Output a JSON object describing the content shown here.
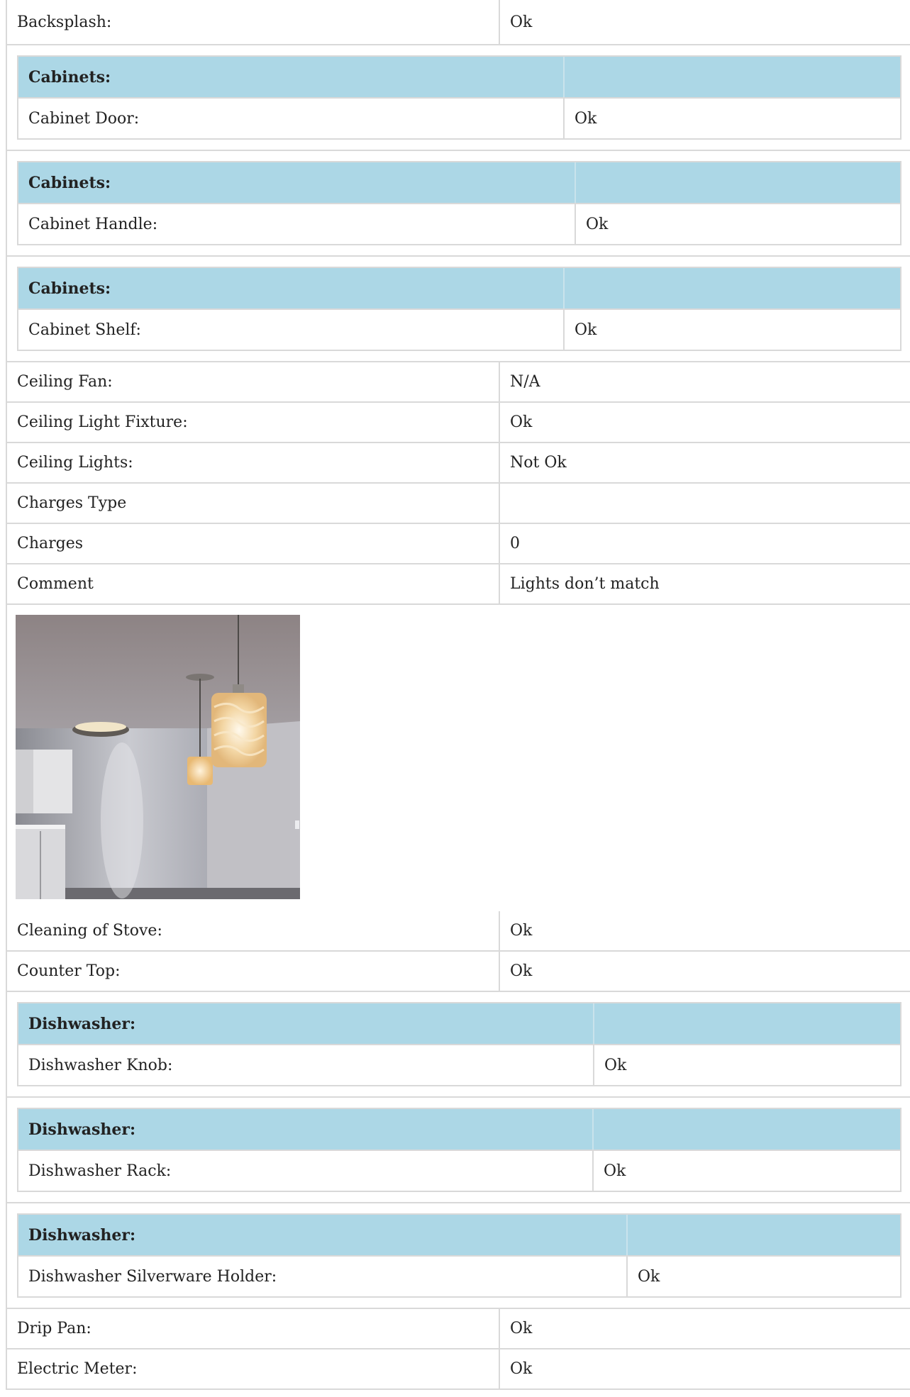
{
  "rows_top": [
    {
      "label": "Backsplash:",
      "value": "Ok"
    }
  ],
  "cabinet_groups": [
    {
      "header": "Cabinets:",
      "item": "Cabinet Door:",
      "value": "Ok"
    },
    {
      "header": "Cabinets:",
      "item": "Cabinet Handle:",
      "value": "Ok"
    },
    {
      "header": "Cabinets:",
      "item": "Cabinet Shelf:",
      "value": "Ok"
    }
  ],
  "rows_middle": [
    {
      "label": "Ceiling Fan:",
      "value": "N/A"
    },
    {
      "label": "Ceiling Light Fixture:",
      "value": "Ok"
    },
    {
      "label": "Ceiling Lights:",
      "value": "Not Ok"
    },
    {
      "label": "Charges Type",
      "value": ""
    },
    {
      "label": "Charges",
      "value": "0"
    },
    {
      "label": "Comment",
      "value": "Lights don’t match"
    }
  ],
  "photo": {
    "subject": "ceiling-lights-photo",
    "colors": {
      "wall": "#9d9ea6",
      "ceiling": "#8a8587",
      "glow": "#f3e7cf",
      "pendant": "#f2c98f"
    }
  },
  "rows_after_photo": [
    {
      "label": "Cleaning of Stove:",
      "value": "Ok"
    },
    {
      "label": "Counter Top:",
      "value": "Ok"
    }
  ],
  "dishwasher_groups": [
    {
      "header": "Dishwasher:",
      "item": "Dishwasher Knob:",
      "value": "Ok"
    },
    {
      "header": "Dishwasher:",
      "item": "Dishwasher Rack:",
      "value": "Ok"
    },
    {
      "header": "Dishwasher:",
      "item": "Dishwasher Silverware Holder:",
      "value": "Ok"
    }
  ],
  "rows_bottom": [
    {
      "label": "Drip Pan:",
      "value": "Ok"
    },
    {
      "label": "Electric Meter:",
      "value": "Ok"
    }
  ],
  "colors": {
    "subheader_bg": "#acd7e6",
    "border": "#d9d9d9"
  }
}
